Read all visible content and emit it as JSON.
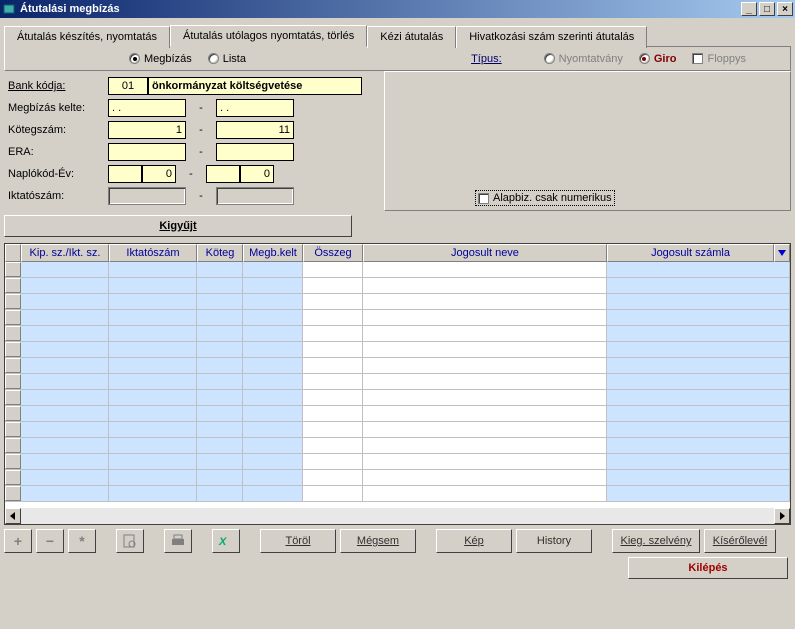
{
  "window": {
    "title": "Átutalási megbízás"
  },
  "tabs": {
    "t1": "Átutalás készítés, nyomtatás",
    "t2": "Átutalás utólagos nyomtatás, törlés",
    "t3": "Kézi átutalás",
    "t4": "Hivatkozási szám szerinti átutalás"
  },
  "radios": {
    "megbizas": "Megbízás",
    "lista": "Lista",
    "tipus": "Típus:",
    "nyomtatvany": "Nyomtatvány",
    "giro": "Giro",
    "floppys": "Floppys"
  },
  "form": {
    "bank_kodja_label": "Bank kódja:",
    "bank_kodja_value": "01",
    "bank_kodja_text": "önkormányzat költségvetése",
    "megbizas_kelte_label": "Megbízás kelte:",
    "megbizas_kelte_from": ". .",
    "megbizas_kelte_to": ". .",
    "kotegszam_label": "Kötegszám:",
    "kotegszam_from": "1",
    "kotegszam_to": "11",
    "era_label": "ERA:",
    "naplokod_label": "Naplókód-Év:",
    "naplokod_a": "",
    "naplokod_b": "0",
    "naplokod_c": "",
    "naplokod_d": "0",
    "iktatoszam_label": "Iktatószám:",
    "alapbiz": "Alapbiz. csak numerikus",
    "dash": "-"
  },
  "kigyujt": "Kigyűjt",
  "grid_headers": {
    "c1": "Kip. sz./Ikt. sz.",
    "c2": "Iktatószám",
    "c3": "Köteg",
    "c4": "Megb.kelt",
    "c5": "Összeg",
    "c6": "Jogosult neve",
    "c7": "Jogosult számla"
  },
  "toolbar": {
    "plus": "+",
    "minus": "−",
    "star": "*",
    "torol": "Töröl",
    "megsem": "Mégsem",
    "kep": "Kép",
    "history": "History",
    "kieg": "Kieg. szelvény",
    "kisero": "Kísérőlevél",
    "kilepes": "Kilépés"
  }
}
